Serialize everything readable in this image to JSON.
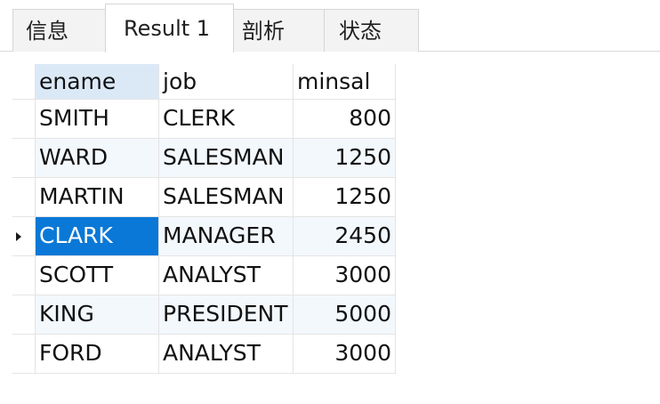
{
  "tabs": [
    {
      "label": "信息",
      "active": false
    },
    {
      "label": "Result 1",
      "active": true
    },
    {
      "label": "剖析",
      "active": false
    },
    {
      "label": "状态",
      "active": false
    }
  ],
  "table": {
    "columns": [
      "ename",
      "job",
      "minsal"
    ],
    "rows": [
      [
        "SMITH",
        "CLERK",
        "800"
      ],
      [
        "WARD",
        "SALESMAN",
        "1250"
      ],
      [
        "MARTIN",
        "SALESMAN",
        "1250"
      ],
      [
        "CLARK",
        "MANAGER",
        "2450"
      ],
      [
        "SCOTT",
        "ANALYST",
        "3000"
      ],
      [
        "KING",
        "PRESIDENT",
        "5000"
      ],
      [
        "FORD",
        "ANALYST",
        "3000"
      ]
    ],
    "current_row_index": 3,
    "selected_cell": "ename"
  },
  "colors": {
    "selected_cell": "#0a78d7",
    "selected_header": "#dbe9f7",
    "alt_row": "#f3f8fd"
  }
}
